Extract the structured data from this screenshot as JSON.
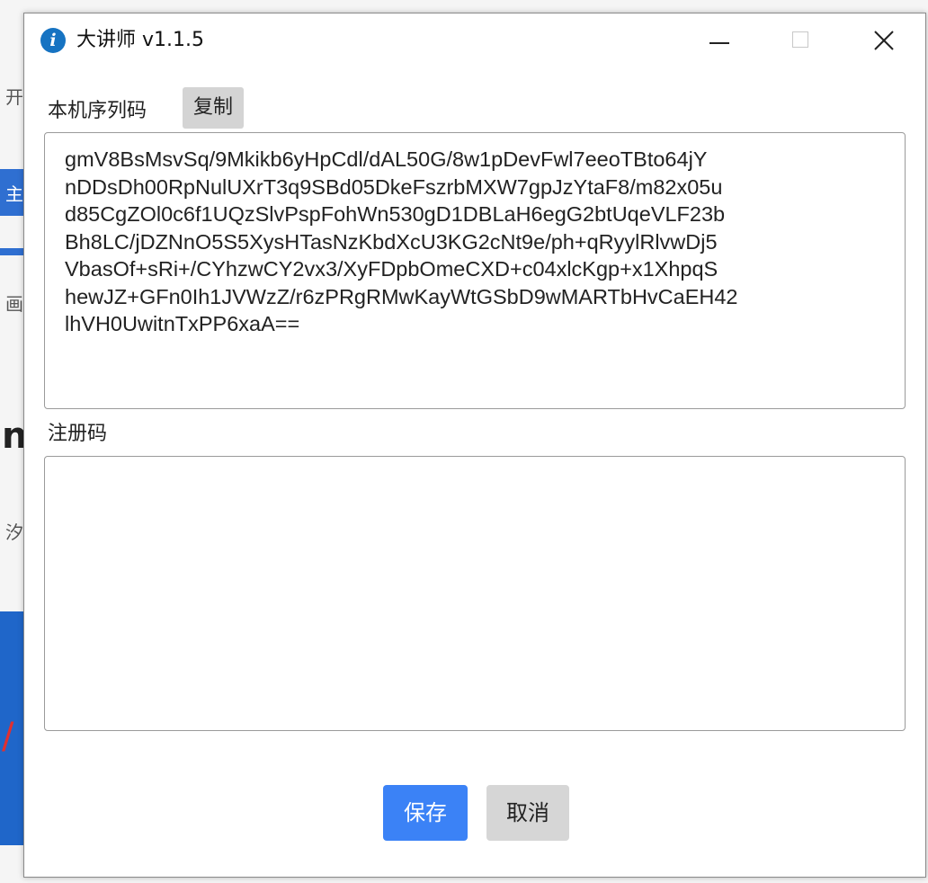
{
  "window": {
    "title": "大讲师 v1.1.5",
    "icon": "info-icon"
  },
  "background": {
    "fragments": [
      "开",
      "主",
      "画",
      "n",
      "汐",
      "/"
    ]
  },
  "serial": {
    "label": "本机序列码",
    "copy_label": "复制",
    "lines": [
      "gmV8BsMsvSq/9Mkikb6yHpCdl/dAL50G/8w1pDevFwl7eeoTBto64jY",
      "nDDsDh00RpNulUXrT3q9SBd05DkeFszrbMXW7gpJzYtaF8/m82x05u",
      "d85CgZOl0c6f1UQzSlvPspFohWn530gD1DBLaH6egG2btUqeVLF23b",
      "Bh8LC/jDZNnO5S5XysHTasNzKbdXcU3KG2cNt9e/ph+qRyylRlvwDj5",
      "VbasOf+sRi+/CYhzwCY2vx3/XyFDpbOmeCXD+c04xlcKgp+x1XhpqS",
      "hewJZ+GFn0Ih1JVWzZ/r6zPRgRMwKayWtGSbD9wMARTbHvCaEH42",
      "lhVH0UwitnTxPP6xaA=="
    ]
  },
  "registration": {
    "label": "注册码",
    "value": ""
  },
  "actions": {
    "save_label": "保存",
    "cancel_label": "取消"
  },
  "colors": {
    "accent": "#3b82f6",
    "icon_blue": "#1673c2"
  }
}
